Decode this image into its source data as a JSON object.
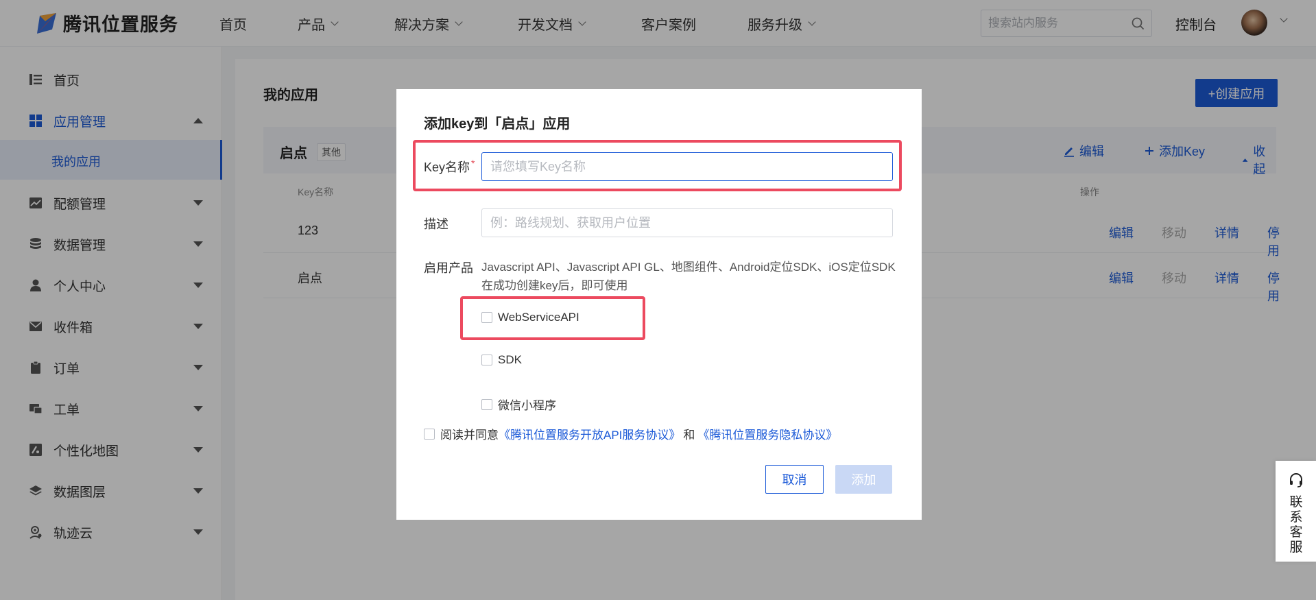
{
  "brand": {
    "name": "腾讯位置服务"
  },
  "nav": {
    "items": [
      {
        "label": "首页",
        "has_dropdown": false
      },
      {
        "label": "产品",
        "has_dropdown": true
      },
      {
        "label": "解决方案",
        "has_dropdown": true
      },
      {
        "label": "开发文档",
        "has_dropdown": true
      },
      {
        "label": "客户案例",
        "has_dropdown": false
      },
      {
        "label": "服务升级",
        "has_dropdown": true
      }
    ],
    "search_placeholder": "搜索站内服务",
    "console": "控制台"
  },
  "sidebar": {
    "items": [
      {
        "label": "首页"
      },
      {
        "label": "应用管理",
        "expanded": true
      },
      {
        "label": "配额管理"
      },
      {
        "label": "数据管理"
      },
      {
        "label": "个人中心"
      },
      {
        "label": "收件箱"
      },
      {
        "label": "订单"
      },
      {
        "label": "工单"
      },
      {
        "label": "个性化地图"
      },
      {
        "label": "数据图层"
      },
      {
        "label": "轨迹云"
      }
    ],
    "sub_item": "我的应用"
  },
  "main": {
    "title": "我的应用",
    "create_button": "+创建应用",
    "app": {
      "name": "启点",
      "tag": "其他",
      "actions": {
        "edit": "编辑",
        "add_key": "添加Key",
        "collapse": "收起"
      }
    },
    "columns": {
      "key_name": "Key名称",
      "ops": "操作"
    },
    "rows": [
      {
        "key_name": "123",
        "ops": [
          "编辑",
          "移动",
          "详情",
          "停用"
        ]
      },
      {
        "key_name": "启点",
        "ops": [
          "编辑",
          "移动",
          "详情",
          "停用"
        ]
      }
    ]
  },
  "modal": {
    "title": "添加key到「启点」应用",
    "key_label": "Key名称",
    "required_mark": "*",
    "key_placeholder": "请您填写Key名称",
    "key_value": "",
    "desc_label": "描述",
    "desc_placeholder": "例：路线规划、获取用户位置",
    "desc_value": "",
    "products_label": "启用产品",
    "products_desc": "Javascript API、Javascript API GL、地图组件、Android定位SDK、iOS定位SDK在成功创建key后，即可使用",
    "options": [
      {
        "label": "WebServiceAPI",
        "checked": false
      },
      {
        "label": "SDK",
        "checked": false
      },
      {
        "label": "微信小程序",
        "checked": false
      }
    ],
    "agree": {
      "prefix": "阅读并同意",
      "link1": "《腾讯位置服务开放API服务协议》",
      "and": "和",
      "link2": "《腾讯位置服务隐私协议》",
      "checked": false
    },
    "cancel": "取消",
    "add": "添加"
  },
  "customer_service": {
    "label": "联系客服"
  },
  "colors": {
    "accent": "#1d5bd8",
    "highlight": "#ec4a5f",
    "disabled_button": "#c9d8f5"
  }
}
